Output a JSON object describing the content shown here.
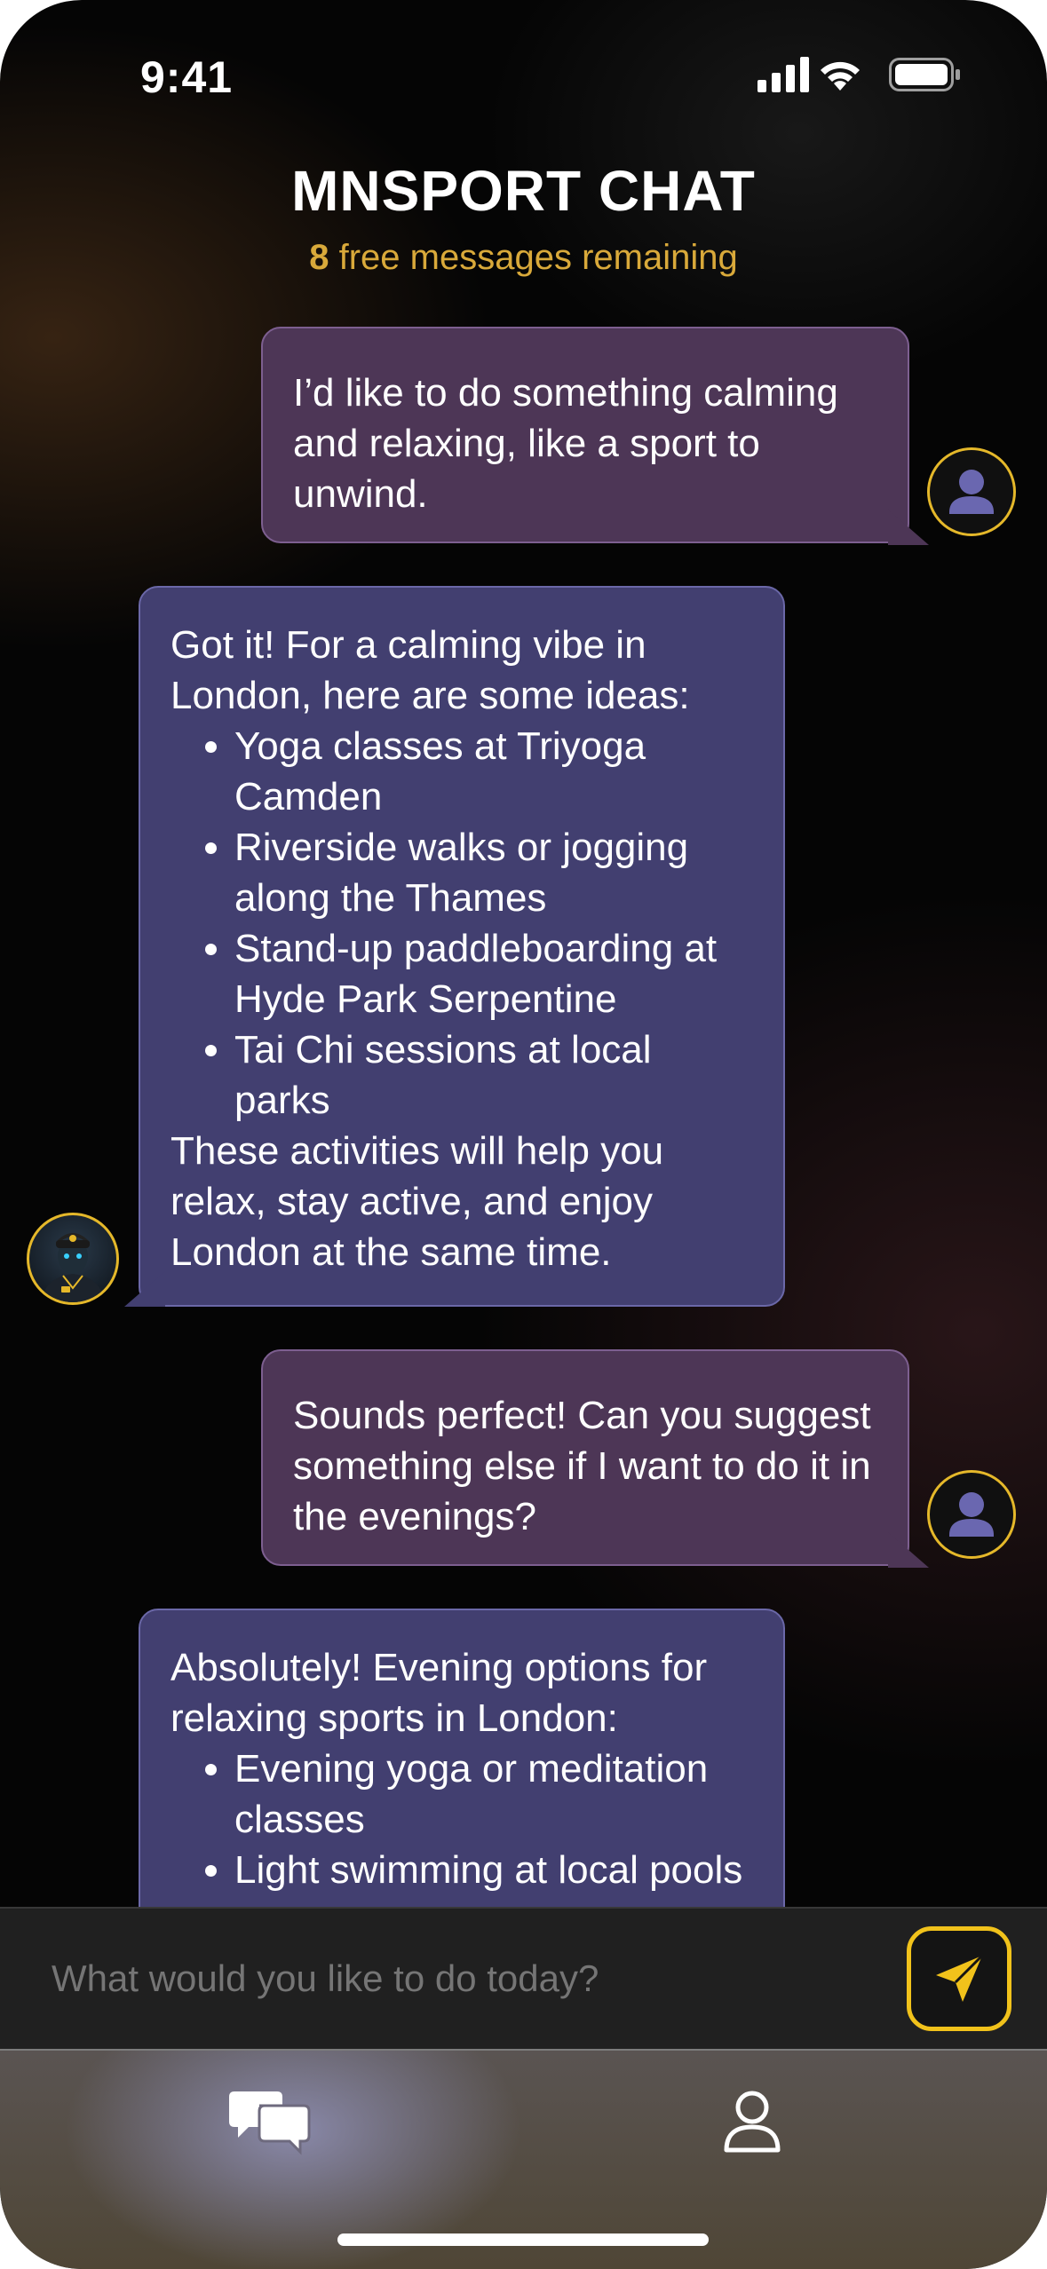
{
  "status_bar": {
    "time": "9:41",
    "icons": [
      "signal-icon",
      "wifi-icon",
      "battery-icon"
    ]
  },
  "header": {
    "title": "MNSPORT CHAT",
    "remaining_count": "8",
    "remaining_text": "free messages remaining"
  },
  "messages": [
    {
      "role": "user",
      "text": "I’d like to do something calming and relaxing, like a sport to unwind."
    },
    {
      "role": "assistant",
      "intro": "Got it! For a calming vibe in London, here are some ideas:",
      "items": [
        "Yoga classes at Triyoga Camden",
        "Riverside walks or jogging along the Thames",
        "Stand-up paddleboarding at Hyde Park Serpentine",
        "Tai Chi sessions at local parks"
      ],
      "outro": "These activities will help you relax, stay active, and enjoy London at the same time."
    },
    {
      "role": "user",
      "text": "Sounds perfect! Can you suggest something else if I want to do it in the evenings?"
    },
    {
      "role": "assistant",
      "intro": "Absolutely! Evening options for relaxing sports in London:",
      "items": [
        "Evening yoga or meditation classes",
        "Light swimming at local pools"
      ]
    }
  ],
  "composer": {
    "placeholder": "What would you like to do today?",
    "send_icon": "send-icon"
  },
  "tab_bar": {
    "tabs": [
      {
        "icon": "chat-bubbles-icon",
        "active": true
      },
      {
        "icon": "profile-icon",
        "active": false
      }
    ]
  },
  "colors": {
    "accent": "#f1c21b",
    "subtitle": "#d9a93a",
    "user_bubble": "#4d3656",
    "assistant_bubble": "#423f70"
  }
}
